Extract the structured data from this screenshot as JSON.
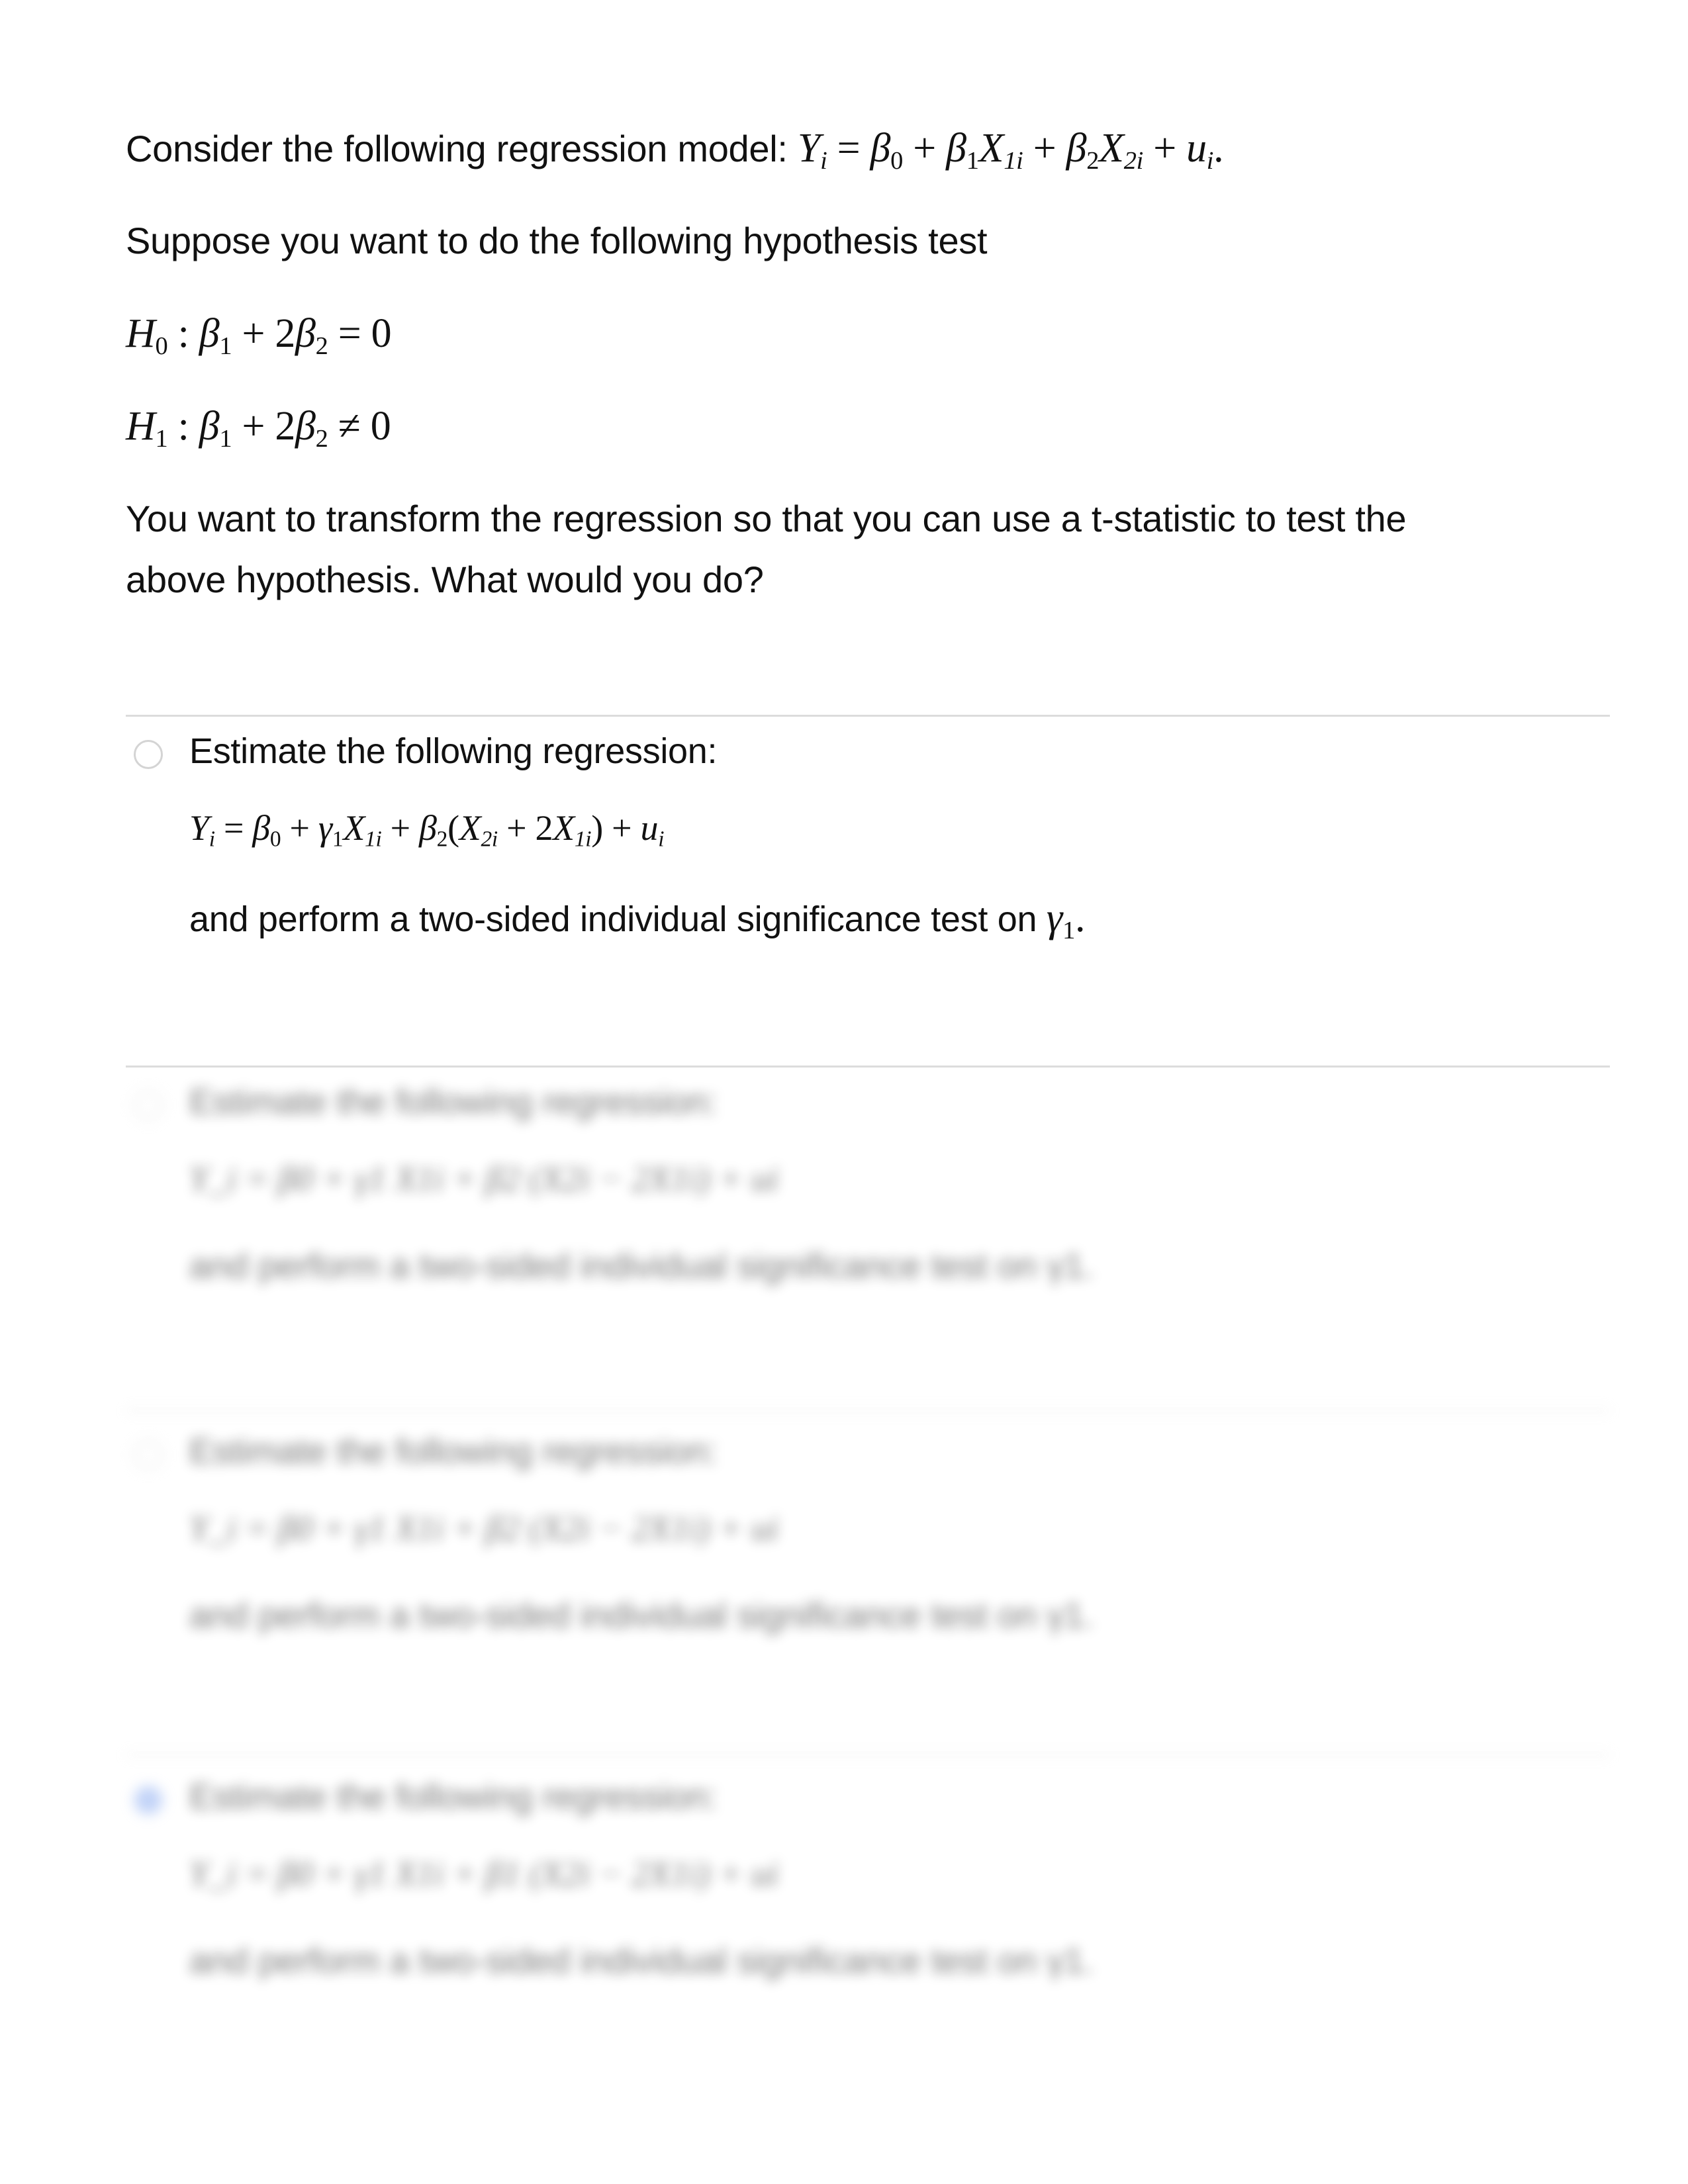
{
  "question": {
    "intro_text": "Consider the following regression model:",
    "model_equation": {
      "Y": "Y",
      "Y_sub": "i",
      "eq": "=",
      "b0": "β",
      "b0_sub": "0",
      "plus1": "+",
      "b1": "β",
      "b1_sub": "1",
      "x1": "X",
      "x1_sub": "1i",
      "plus2": "+",
      "b2": "β",
      "b2_sub": "2",
      "x2": "X",
      "x2_sub": "2i",
      "plus3": "+",
      "u": "u",
      "u_sub": "i",
      "end": "."
    },
    "test_intro": "Suppose you want to do the following hypothesis test",
    "h0": {
      "H": "H",
      "sub": "0",
      "colon": ":",
      "b1": "β",
      "b1_sub": "1",
      "plus": "+",
      "two": "2",
      "b2": "β",
      "b2_sub": "2",
      "rel": "=",
      "rhs": "0"
    },
    "h1": {
      "H": "H",
      "sub": "1",
      "colon": ":",
      "b1": "β",
      "b1_sub": "1",
      "plus": "+",
      "two": "2",
      "b2": "β",
      "b2_sub": "2",
      "rel": "≠",
      "rhs": "0"
    },
    "prompt_line1": "You want to transform the regression so that you can use a t-statistic to test the",
    "prompt_line2": "above hypothesis. What would you do?"
  },
  "options": [
    {
      "label": "Estimate the following regression:",
      "equation": {
        "Y": "Y",
        "Y_sub": "i",
        "eq": "=",
        "b0": "β",
        "b0_sub": "0",
        "plus1": "+",
        "g1": "γ",
        "g1_sub": "1",
        "x1": "X",
        "x1_sub": "1i",
        "plus2": "+",
        "b2": "β",
        "b2_sub": "2",
        "lp": "(",
        "x2": "X",
        "x2_sub": "2i",
        "op": "+",
        "two": "2",
        "x1b": "X",
        "x1b_sub": "1i",
        "rp": ")",
        "plus3": "+",
        "u": "u",
        "u_sub": "i"
      },
      "conclusion": "and perform a two-sided individual significance test on",
      "target": "γ",
      "target_sub": "1",
      "target_end": ".",
      "selected": false,
      "blurred": false
    },
    {
      "label": "Estimate the following regression:",
      "equation_text": "Y_i = β0 + γ1 X1i + β2 (X2i − 2X1i) + ui",
      "conclusion": "and perform a two-sided individual significance test on γ1.",
      "selected": false,
      "blurred": true
    },
    {
      "label": "Estimate the following regression:",
      "equation_text": "Y_i = β0 + γ1 X1i + β2 (X2i − 2X1i) + ui",
      "conclusion": "and perform a two-sided individual significance test on γ1.",
      "selected": false,
      "blurred": true
    },
    {
      "label": "Estimate the following regression:",
      "equation_text": "Y_i = β0 + γ1 X1i + β1 (X2i − 2X1i) + ui",
      "conclusion": "and perform a two-sided individual significance test on γ1.",
      "selected": true,
      "blurred": true
    }
  ],
  "colors": {
    "selected_radio": "#8eaef2",
    "divider": "#dcdcdc",
    "text": "#111111"
  }
}
